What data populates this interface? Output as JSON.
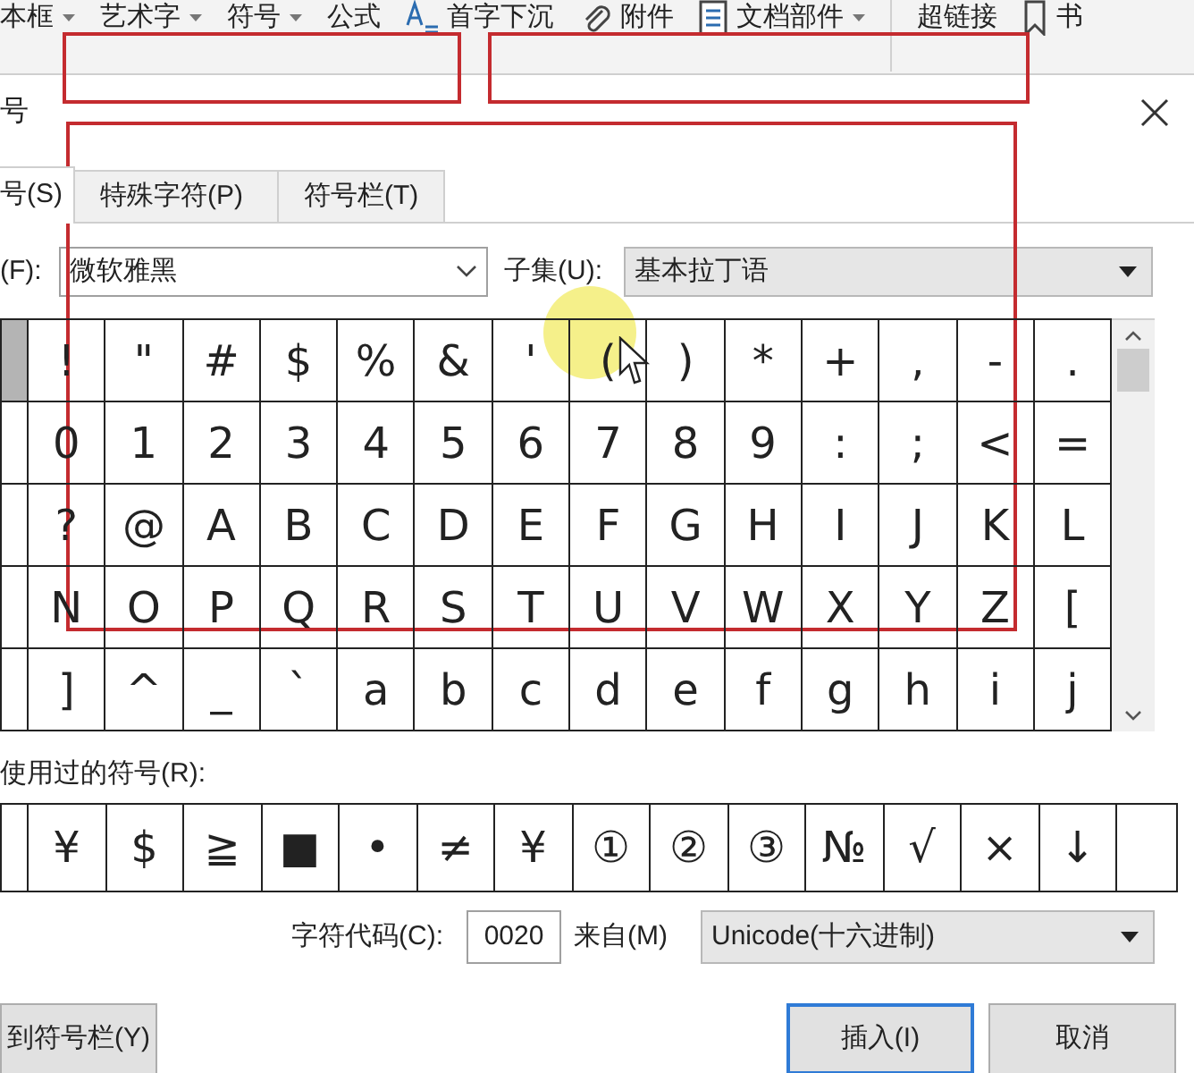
{
  "toolbar": {
    "items": [
      {
        "kind": "dropdown",
        "label": "本框"
      },
      {
        "kind": "dropdown",
        "label": "艺术字"
      },
      {
        "kind": "dropdown",
        "label": "符号"
      },
      {
        "kind": "button",
        "label": "公式"
      },
      {
        "kind": "button",
        "label": "首字下沉"
      },
      {
        "kind": "button",
        "label": "附件"
      },
      {
        "kind": "dropdown",
        "label": "文档部件"
      },
      {
        "kind": "separator"
      },
      {
        "kind": "button",
        "label": "超链接"
      },
      {
        "kind": "button",
        "label": "书"
      }
    ]
  },
  "dialog": {
    "title": "号",
    "tabs": [
      {
        "label": "号(S)",
        "selected": true
      },
      {
        "label": "特殊字符(P)",
        "selected": false
      },
      {
        "label": "符号栏(T)",
        "selected": false
      }
    ],
    "font": {
      "label": "(F):",
      "value": "微软雅黑"
    },
    "subset": {
      "label": "子集(U):",
      "value": "基本拉丁语"
    },
    "symbol_grid": {
      "rows": [
        {
          "cells": [
            {
              "selected": true
            },
            {
              "char": "!",
              "selected": false
            },
            {
              "char": "\"",
              "selected": false
            },
            {
              "char": "#",
              "selected": false
            },
            {
              "char": "$",
              "selected": false
            },
            {
              "char": "%",
              "selected": false
            },
            {
              "char": "&",
              "selected": false
            },
            {
              "char": "'",
              "selected": false
            },
            {
              "char": "(",
              "selected": false
            },
            {
              "char": ")",
              "selected": false
            },
            {
              "char": "*",
              "selected": false
            },
            {
              "char": "+",
              "selected": false
            },
            {
              "char": ",",
              "selected": false
            },
            {
              "char": "-",
              "selected": false
            },
            {
              "char": ".",
              "selected": false
            }
          ]
        },
        {
          "cells": [
            {
              "selected": false
            },
            {
              "char": "0",
              "selected": false
            },
            {
              "char": "1",
              "selected": false
            },
            {
              "char": "2",
              "selected": false
            },
            {
              "char": "3",
              "selected": false
            },
            {
              "char": "4",
              "selected": false
            },
            {
              "char": "5",
              "selected": false
            },
            {
              "char": "6",
              "selected": false
            },
            {
              "char": "7",
              "selected": false
            },
            {
              "char": "8",
              "selected": false
            },
            {
              "char": "9",
              "selected": false
            },
            {
              "char": ":",
              "selected": false
            },
            {
              "char": ";",
              "selected": false
            },
            {
              "char": "<",
              "selected": false
            },
            {
              "char": "=",
              "selected": false
            }
          ]
        },
        {
          "cells": [
            {
              "selected": false
            },
            {
              "char": "?",
              "selected": false
            },
            {
              "char": "@",
              "selected": false
            },
            {
              "char": "A",
              "selected": false
            },
            {
              "char": "B",
              "selected": false
            },
            {
              "char": "C",
              "selected": false
            },
            {
              "char": "D",
              "selected": false
            },
            {
              "char": "E",
              "selected": false
            },
            {
              "char": "F",
              "selected": false
            },
            {
              "char": "G",
              "selected": false
            },
            {
              "char": "H",
              "selected": false
            },
            {
              "char": "I",
              "selected": false
            },
            {
              "char": "J",
              "selected": false
            },
            {
              "char": "K",
              "selected": false
            },
            {
              "char": "L",
              "selected": false
            }
          ]
        },
        {
          "cells": [
            {
              "selected": false
            },
            {
              "char": "N",
              "selected": false
            },
            {
              "char": "O",
              "selected": false
            },
            {
              "char": "P",
              "selected": false
            },
            {
              "char": "Q",
              "selected": false
            },
            {
              "char": "R",
              "selected": false
            },
            {
              "char": "S",
              "selected": false
            },
            {
              "char": "T",
              "selected": false
            },
            {
              "char": "U",
              "selected": false
            },
            {
              "char": "V",
              "selected": false
            },
            {
              "char": "W",
              "selected": false
            },
            {
              "char": "X",
              "selected": false
            },
            {
              "char": "Y",
              "selected": false
            },
            {
              "char": "Z",
              "selected": false
            },
            {
              "char": "[",
              "selected": false
            }
          ]
        },
        {
          "cells": [
            {
              "selected": false
            },
            {
              "char": "]",
              "selected": false
            },
            {
              "char": "^",
              "selected": false
            },
            {
              "char": "_",
              "selected": false
            },
            {
              "char": "`",
              "selected": false
            },
            {
              "char": "a",
              "selected": false
            },
            {
              "char": "b",
              "selected": false
            },
            {
              "char": "c",
              "selected": false
            },
            {
              "char": "d",
              "selected": false
            },
            {
              "char": "e",
              "selected": false
            },
            {
              "char": "f",
              "selected": false
            },
            {
              "char": "g",
              "selected": false
            },
            {
              "char": "h",
              "selected": false
            },
            {
              "char": "i",
              "selected": false
            },
            {
              "char": "j",
              "selected": false
            }
          ]
        }
      ]
    },
    "recent": {
      "label": "使用过的符号(R):",
      "symbols": [
        "¥",
        "$",
        "≧",
        "■",
        "•",
        "≠",
        "¥",
        "①",
        "②",
        "③",
        "№",
        "√",
        "×",
        "↓"
      ]
    },
    "char_code": {
      "label": "字符代码(C):",
      "value": "0020"
    },
    "from": {
      "label": "来自(M)",
      "value": "Unicode(十六进制)"
    },
    "buttons": [
      {
        "label": "到符号栏(Y)",
        "default": false
      },
      {
        "label": "插入(I)",
        "default": true
      },
      {
        "label": "取消",
        "default": false
      }
    ]
  }
}
